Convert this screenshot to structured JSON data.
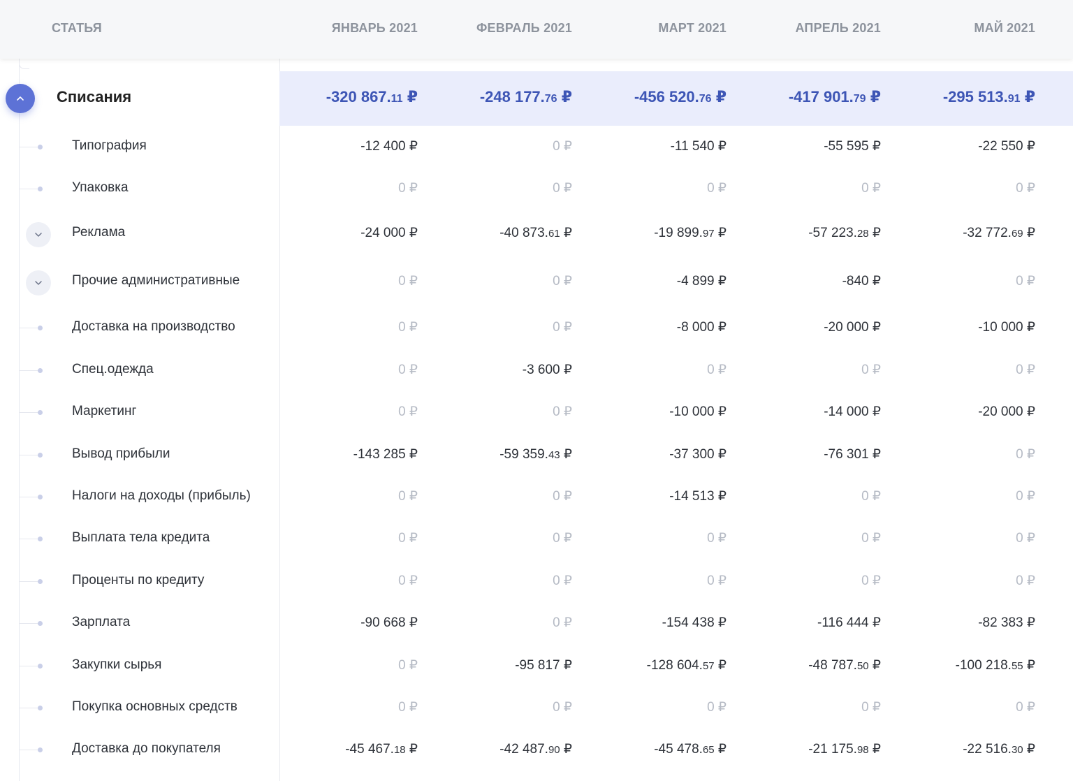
{
  "header": {
    "article": "СТАТЬЯ",
    "months": [
      "ЯНВАРЬ 2021",
      "ФЕВРАЛЬ 2021",
      "МАРТ 2021",
      "АПРЕЛЬ 2021",
      "МАЙ 2021"
    ]
  },
  "group": {
    "label": "Списания",
    "values": [
      {
        "main": "-320 867.",
        "cents": "11",
        "cur": " ₽"
      },
      {
        "main": "-248 177.",
        "cents": "76",
        "cur": " ₽"
      },
      {
        "main": "-456 520.",
        "cents": "76",
        "cur": " ₽"
      },
      {
        "main": "-417 901.",
        "cents": "79",
        "cur": " ₽"
      },
      {
        "main": "-295 513.",
        "cents": "91",
        "cur": " ₽"
      }
    ]
  },
  "rows": [
    {
      "label": "Типография",
      "type": "dot",
      "values": [
        {
          "main": "-12 400 ₽"
        },
        {
          "main": "0 ₽",
          "zero": true
        },
        {
          "main": "-11 540 ₽"
        },
        {
          "main": "-55 595 ₽"
        },
        {
          "main": "-22 550 ₽"
        }
      ]
    },
    {
      "label": "Упаковка",
      "type": "dot",
      "values": [
        {
          "main": "0 ₽",
          "zero": true
        },
        {
          "main": "0 ₽",
          "zero": true
        },
        {
          "main": "0 ₽",
          "zero": true
        },
        {
          "main": "0 ₽",
          "zero": true
        },
        {
          "main": "0 ₽",
          "zero": true
        }
      ]
    },
    {
      "label": "Реклама",
      "type": "expand",
      "values": [
        {
          "main": "-24 000 ₽"
        },
        {
          "main": "-40 873.",
          "cents": "61",
          "cur": " ₽"
        },
        {
          "main": "-19 899.",
          "cents": "97",
          "cur": " ₽"
        },
        {
          "main": "-57 223.",
          "cents": "28",
          "cur": " ₽"
        },
        {
          "main": "-32 772.",
          "cents": "69",
          "cur": " ₽"
        }
      ]
    },
    {
      "label": "Прочие административные",
      "type": "expand",
      "values": [
        {
          "main": "0 ₽",
          "zero": true
        },
        {
          "main": "0 ₽",
          "zero": true
        },
        {
          "main": "-4 899 ₽"
        },
        {
          "main": "-840 ₽"
        },
        {
          "main": "0 ₽",
          "zero": true
        }
      ]
    },
    {
      "label": "Доставка на производство",
      "type": "dot",
      "values": [
        {
          "main": "0 ₽",
          "zero": true
        },
        {
          "main": "0 ₽",
          "zero": true
        },
        {
          "main": "-8 000 ₽"
        },
        {
          "main": "-20 000 ₽"
        },
        {
          "main": "-10 000 ₽"
        }
      ]
    },
    {
      "label": "Спец.одежда",
      "type": "dot",
      "values": [
        {
          "main": "0 ₽",
          "zero": true
        },
        {
          "main": "-3 600 ₽"
        },
        {
          "main": "0 ₽",
          "zero": true
        },
        {
          "main": "0 ₽",
          "zero": true
        },
        {
          "main": "0 ₽",
          "zero": true
        }
      ]
    },
    {
      "label": "Маркетинг",
      "type": "dot",
      "values": [
        {
          "main": "0 ₽",
          "zero": true
        },
        {
          "main": "0 ₽",
          "zero": true
        },
        {
          "main": "-10 000 ₽"
        },
        {
          "main": "-14 000 ₽"
        },
        {
          "main": "-20 000 ₽"
        }
      ]
    },
    {
      "label": "Вывод прибыли",
      "type": "dot",
      "values": [
        {
          "main": "-143 285 ₽"
        },
        {
          "main": "-59 359.",
          "cents": "43",
          "cur": " ₽"
        },
        {
          "main": "-37 300 ₽"
        },
        {
          "main": "-76 301 ₽"
        },
        {
          "main": "0 ₽",
          "zero": true
        }
      ]
    },
    {
      "label": "Налоги на доходы (прибыль)",
      "type": "dot",
      "values": [
        {
          "main": "0 ₽",
          "zero": true
        },
        {
          "main": "0 ₽",
          "zero": true
        },
        {
          "main": "-14 513 ₽"
        },
        {
          "main": "0 ₽",
          "zero": true
        },
        {
          "main": "0 ₽",
          "zero": true
        }
      ]
    },
    {
      "label": "Выплата тела кредита",
      "type": "dot",
      "values": [
        {
          "main": "0 ₽",
          "zero": true
        },
        {
          "main": "0 ₽",
          "zero": true
        },
        {
          "main": "0 ₽",
          "zero": true
        },
        {
          "main": "0 ₽",
          "zero": true
        },
        {
          "main": "0 ₽",
          "zero": true
        }
      ]
    },
    {
      "label": "Проценты по кредиту",
      "type": "dot",
      "values": [
        {
          "main": "0 ₽",
          "zero": true
        },
        {
          "main": "0 ₽",
          "zero": true
        },
        {
          "main": "0 ₽",
          "zero": true
        },
        {
          "main": "0 ₽",
          "zero": true
        },
        {
          "main": "0 ₽",
          "zero": true
        }
      ]
    },
    {
      "label": "Зарплата",
      "type": "dot",
      "values": [
        {
          "main": "-90 668 ₽"
        },
        {
          "main": "0 ₽",
          "zero": true
        },
        {
          "main": "-154 438 ₽"
        },
        {
          "main": "-116 444 ₽"
        },
        {
          "main": "-82 383 ₽"
        }
      ]
    },
    {
      "label": "Закупки сырья",
      "type": "dot",
      "values": [
        {
          "main": "0 ₽",
          "zero": true
        },
        {
          "main": "-95 817 ₽"
        },
        {
          "main": "-128 604.",
          "cents": "57",
          "cur": " ₽"
        },
        {
          "main": "-48 787.",
          "cents": "50",
          "cur": " ₽"
        },
        {
          "main": "-100 218.",
          "cents": "55",
          "cur": " ₽"
        }
      ]
    },
    {
      "label": "Покупка основных средств",
      "type": "dot",
      "values": [
        {
          "main": "0 ₽",
          "zero": true
        },
        {
          "main": "0 ₽",
          "zero": true
        },
        {
          "main": "0 ₽",
          "zero": true
        },
        {
          "main": "0 ₽",
          "zero": true
        },
        {
          "main": "0 ₽",
          "zero": true
        }
      ]
    },
    {
      "label": "Доставка до покупателя",
      "type": "dot",
      "values": [
        {
          "main": "-45 467.",
          "cents": "18",
          "cur": " ₽"
        },
        {
          "main": "-42 487.",
          "cents": "90",
          "cur": " ₽"
        },
        {
          "main": "-45 478.",
          "cents": "65",
          "cur": " ₽"
        },
        {
          "main": "-21 175.",
          "cents": "98",
          "cur": " ₽"
        },
        {
          "main": "-22 516.",
          "cents": "30",
          "cur": " ₽"
        }
      ]
    }
  ]
}
